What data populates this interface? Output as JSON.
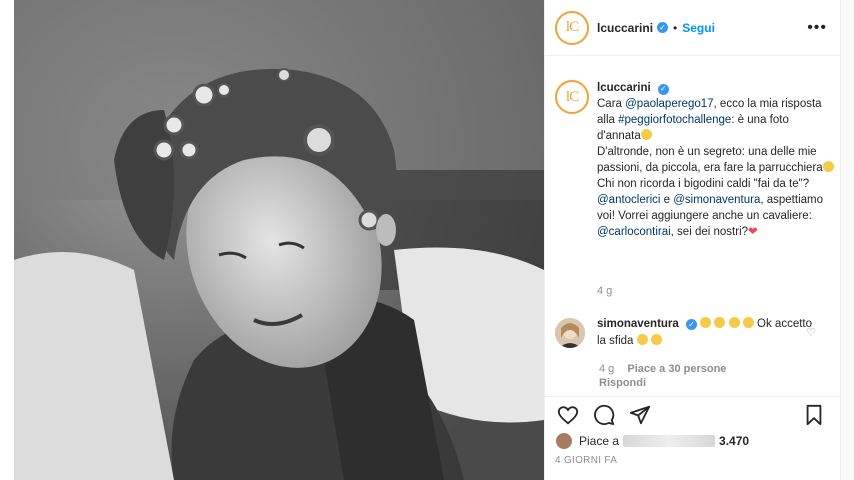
{
  "post": {
    "author": "lcuccarini",
    "follow_label": "Segui",
    "dot": "•",
    "more_label": "•••",
    "avatar_glyph": "lC",
    "caption": {
      "line1_pre": "Cara ",
      "mention1": "@paolaperego17",
      "line1_post": ", ecco la mia risposta alla ",
      "hashtag": "#peggiorfotochallenge",
      "line2": ": è una foto d'annata",
      "line3": "D'altronde, non è un segreto: una delle mie passioni, da piccola, era fare la parrucchiera",
      "line4_pre": "Chi non ricorda i bigodini caldi \"fai da te\"? ",
      "mention2": "@antoclerici",
      "and": " e ",
      "mention3": "@simonaventura",
      "line4_post": ", aspettiamo voi! Vorrei aggiungere anche un cavaliere: ",
      "mention4": "@carlocontirai",
      "line4_end": ", sei dei nostri?"
    },
    "caption_time": "4 g"
  },
  "comment": {
    "author": "simonaventura",
    "text": "Ok accetto la sfida",
    "time": "4 g",
    "likes_label": "Piace a 30 persone",
    "reply_label": "Rispondi"
  },
  "footer": {
    "likes_prefix": "Piace a",
    "likes_suffix": "3.470",
    "date": "4 GIORNI FA"
  },
  "icons": {
    "like": "heart-icon",
    "comment": "comment-icon",
    "share": "paper-plane-icon",
    "save": "bookmark-icon",
    "verified": "verified-badge-icon"
  },
  "colors": {
    "accent": "#0095f6",
    "verified": "#3897f0",
    "ring": "#f0a23a"
  }
}
